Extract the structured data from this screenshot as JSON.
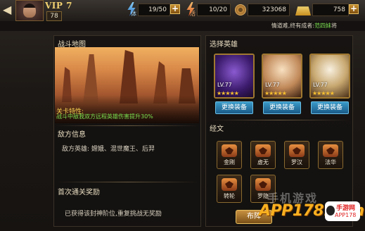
{
  "header": {
    "vip": "VIP 7",
    "level": "78",
    "stamina": "19/50",
    "energy": "10/20",
    "coins": "323068",
    "gold": "758"
  },
  "quote": {
    "text": "情道难,终有成者:",
    "who": "范四妹",
    "end": "将"
  },
  "left": {
    "map_title": "战斗地图",
    "feature_title": "关卡特性:",
    "feature_text": "战斗中敌我双方远程英雄伤害提升30%",
    "enemy_title": "敌方信息",
    "enemy_text": "敌方英雄: 嫦娥、混世魔王、后羿",
    "first_title": "首次通关奖励",
    "first_text": "已获得该封神阶位,重复挑战无奖励"
  },
  "right": {
    "hero_title": "选择英雄",
    "heroes": [
      {
        "lv": "LV.77",
        "stars": "★★★★★"
      },
      {
        "lv": "LV.77",
        "stars": "★★★★★"
      },
      {
        "lv": "LV.77",
        "stars": "★★★★★"
      }
    ],
    "equip_label": "更换装备",
    "scripture_title": "经文",
    "scriptures": [
      "金刚",
      "虚无",
      "罗汉",
      "法华",
      "转轮",
      "罗隐"
    ],
    "buzhen": "布阵"
  },
  "watermark": {
    "zh": "手机游戏",
    "site": "APP178.com",
    "logo1": "手游网",
    "logo2": "APP178"
  },
  "colors": {
    "accent_gold": "#f8c030",
    "feature_green": "#7ae050",
    "button_blue": "#3a9ac8"
  }
}
